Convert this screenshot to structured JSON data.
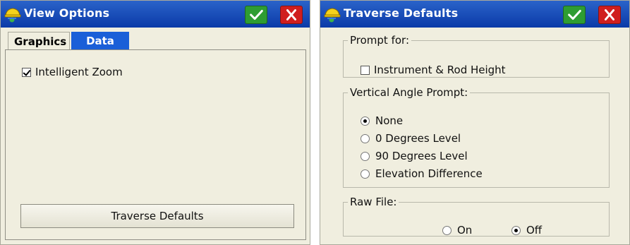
{
  "view_options": {
    "title": "View Options",
    "tabs": [
      "Graphics",
      "Data"
    ],
    "intelligent_zoom": {
      "label": "Intelligent Zoom",
      "checked": true
    },
    "traverse_defaults_button": "Traverse Defaults"
  },
  "traverse_defaults": {
    "title": "Traverse Defaults",
    "prompt_for": {
      "legend": "Prompt for:",
      "instrument_rod": {
        "label": "Instrument & Rod Height",
        "checked": false
      }
    },
    "vertical_angle_prompt": {
      "legend": "Vertical Angle Prompt:",
      "options": [
        "None",
        "0 Degrees Level",
        "90 Degrees Level",
        "Elevation Difference"
      ],
      "selected": "None"
    },
    "raw_file": {
      "legend": "Raw File:",
      "options": [
        "On",
        "Off"
      ],
      "selected": "Off"
    }
  },
  "icons": {
    "app": "hardhat-app-icon",
    "ok": "check-icon",
    "close": "close-icon"
  },
  "colors": {
    "titlebar": "#0b3aa8",
    "ok_button": "#2e9d32",
    "close_button": "#d01e1e",
    "active_tab": "#1a5fd8",
    "panel_bg": "#f0eedf"
  }
}
